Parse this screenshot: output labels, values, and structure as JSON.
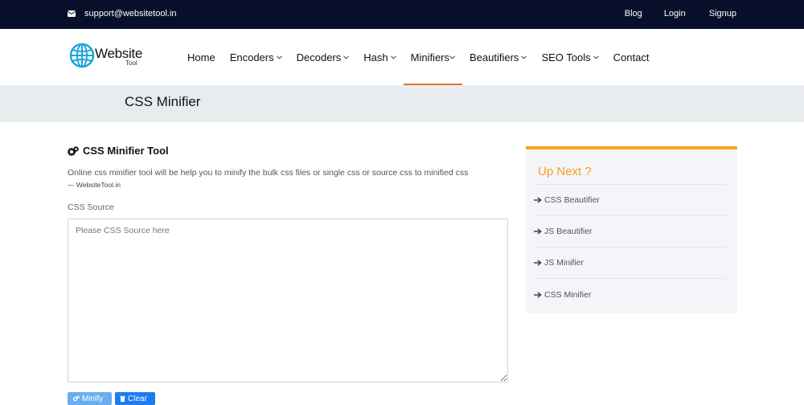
{
  "topbar": {
    "email": "support@websitetool.in",
    "links": {
      "blog": "Blog",
      "login": "Login",
      "signup": "Signup"
    }
  },
  "logo": {
    "brand": "Website",
    "sub": "Tool"
  },
  "nav": {
    "items": [
      {
        "label": "Home"
      },
      {
        "label": "Encoders"
      },
      {
        "label": "Decoders"
      },
      {
        "label": "Hash"
      },
      {
        "label": "Minifiers"
      },
      {
        "label": "Beautifiers"
      },
      {
        "label": "SEO Tools"
      },
      {
        "label": "Contact"
      }
    ],
    "active": "Minifiers"
  },
  "page": {
    "title": "CSS Minifier"
  },
  "tool": {
    "heading": "CSS Minifier Tool",
    "description": "Online css minifier tool will be help you to minify the bulk css files or single css or source css to minified css",
    "cite": "— WebsiteTool.in",
    "source_label": "CSS Source",
    "source_placeholder": "Please CSS Source here",
    "source_value": "",
    "buttons": {
      "minify": "Minify",
      "clear": "Clear"
    }
  },
  "sidebar": {
    "heading": "Up Next ?",
    "links": [
      {
        "label": "CSS Beautifier"
      },
      {
        "label": "JS Beautifier"
      },
      {
        "label": "JS Minifier"
      },
      {
        "label": "CSS Minifier"
      }
    ]
  },
  "colors": {
    "topbar_bg": "#070f2b",
    "accent_orange": "#e8722c",
    "upnext_yellow": "#f2a81d",
    "button_blue": "#1e7cf2"
  },
  "icons": {
    "email": "envelope-icon",
    "logo": "globe-icon",
    "dropdown": "chevron-down-icon",
    "tool": "cogs-icon",
    "link": "arrow-right-icon",
    "clear": "trash-icon"
  }
}
